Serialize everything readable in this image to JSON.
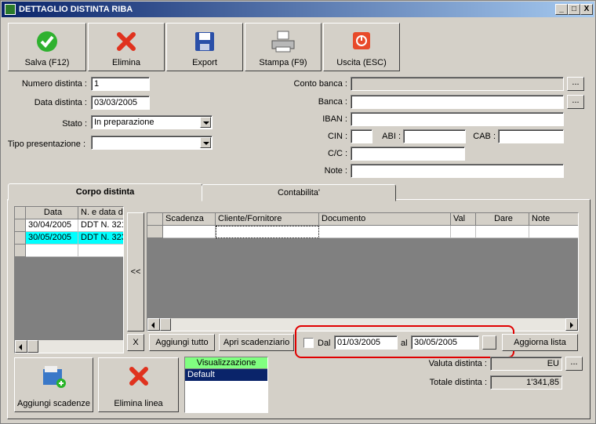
{
  "window": {
    "title": "DETTAGLIO DISTINTA RIBA",
    "min": "_",
    "max": "□",
    "close": "X"
  },
  "toolbar": {
    "save": "Salva (F12)",
    "delete": "Elimina",
    "export": "Export",
    "print": "Stampa (F9)",
    "exit": "Uscita (ESC)"
  },
  "form": {
    "numero_label": "Numero distinta :",
    "numero_value": "1",
    "data_label": "Data distinta :",
    "data_value": "03/03/2005",
    "stato_label": "Stato :",
    "stato_value": "In preparazione",
    "tipo_label": "Tipo presentazione :",
    "tipo_value": "",
    "conto_label": "Conto banca :",
    "conto_value": "",
    "banca_label": "Banca :",
    "banca_value": "",
    "iban_label": "IBAN :",
    "iban_value": "",
    "cin_label": "CIN :",
    "cin_value": "",
    "abi_label": "ABI :",
    "abi_value": "",
    "cab_label": "CAB :",
    "cab_value": "",
    "cc_label": "C/C :",
    "cc_value": "",
    "note_label": "Note :",
    "note_value": "",
    "browse": "..."
  },
  "tabs": [
    {
      "label": "Corpo distinta",
      "active": true
    },
    {
      "label": "Contabilita'",
      "active": false
    }
  ],
  "left_grid": {
    "columns": [
      "Data",
      "N. e data d"
    ],
    "rows": [
      {
        "data": "30/04/2005",
        "num": "DDT N. 321",
        "selected": false
      },
      {
        "data": "30/05/2005",
        "num": "DDT N. 323",
        "selected": true
      }
    ]
  },
  "move_button": "<<",
  "right_grid": {
    "columns": [
      "Scadenza",
      "Cliente/Fornitore",
      "Documento",
      "Val",
      "Dare",
      "Note"
    ]
  },
  "bottom_bar": {
    "clear": "X",
    "add_all": "Aggiungi tutto",
    "open_scad": "Apri scadenziario",
    "dal_label": "Dal",
    "dal_value": "01/03/2005",
    "al_label": "al",
    "al_value": "30/05/2005",
    "refresh": "Aggiorna lista"
  },
  "bottom": {
    "add_scad": "Aggiungi scadenze",
    "del_line": "Elimina linea",
    "vis_header": "Visualizzazione",
    "vis_items": [
      "Default"
    ],
    "valuta_label": "Valuta distinta :",
    "valuta_value": "EU",
    "totale_label": "Totale distinta :",
    "totale_value": "1'341,85"
  },
  "colors": {
    "title_bar": "#0a246a",
    "selected_row": "#00ffff",
    "vis_header": "#80ff80",
    "highlight": "#e00000"
  }
}
